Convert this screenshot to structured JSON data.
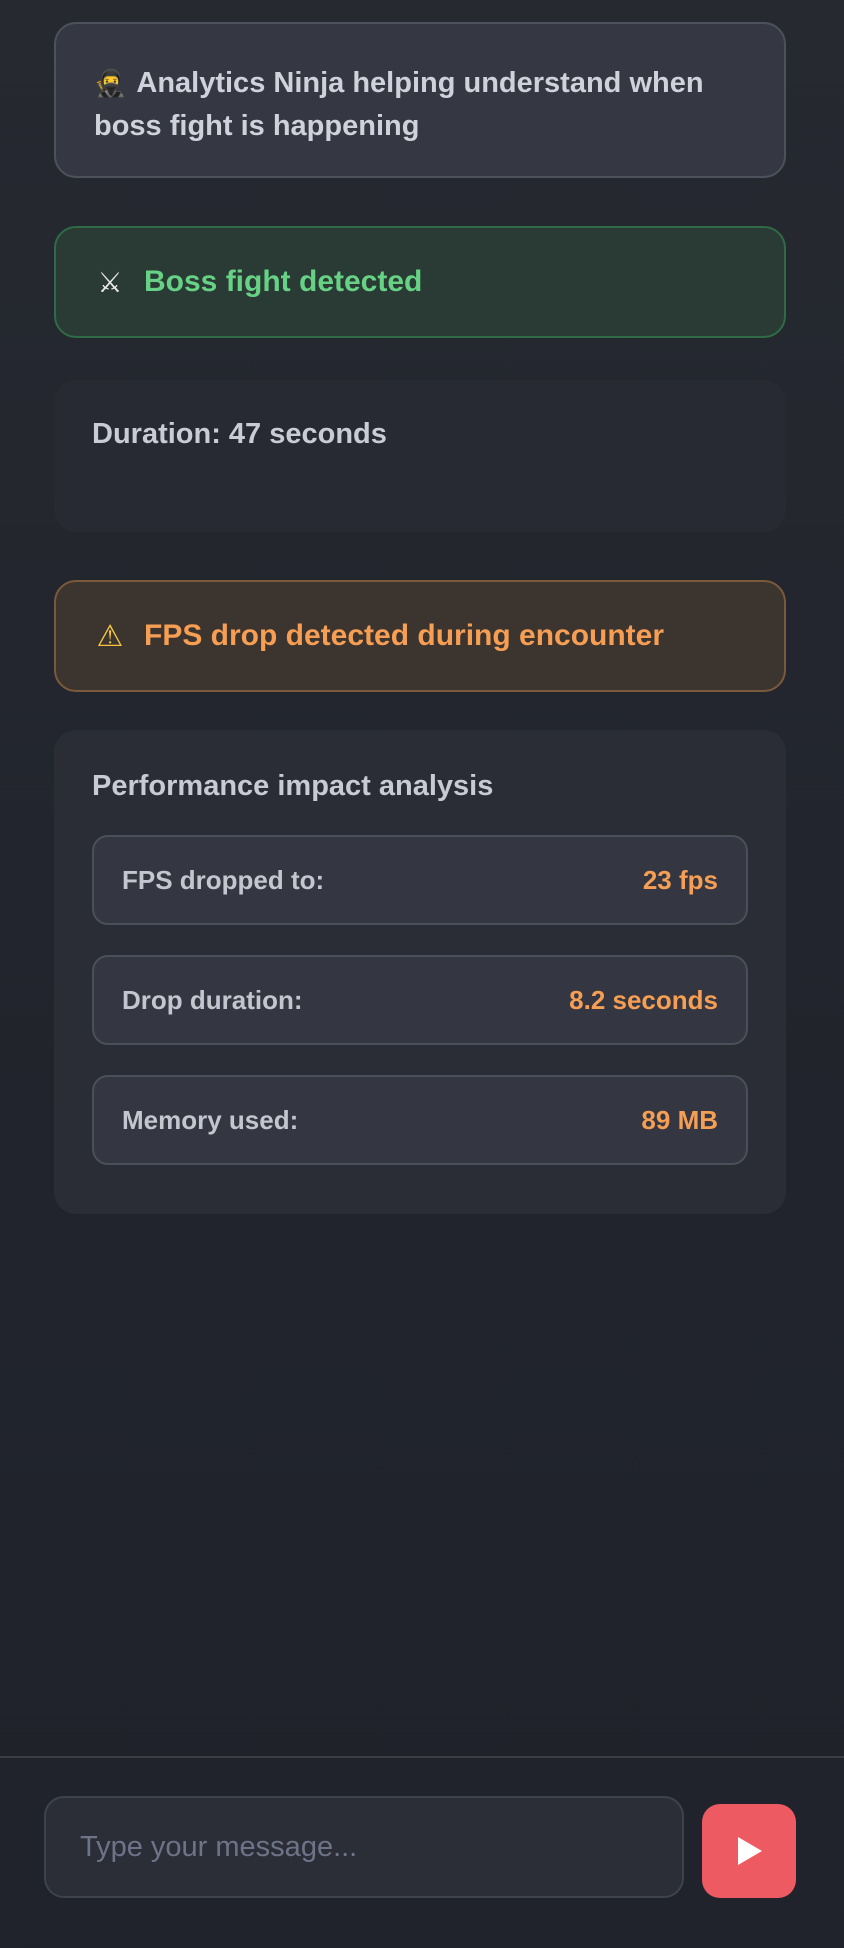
{
  "chat": {
    "intro": {
      "emoji": "🥷",
      "text": "Analytics Ninja helping understand when boss fight is happening"
    },
    "boss_alert": {
      "icon": "crossed-swords-icon",
      "glyph": "⚔",
      "text": "Boss fight detected"
    },
    "duration": {
      "text": "Duration: 47 seconds"
    },
    "fps_warning": {
      "icon": "warning-icon",
      "glyph": "⚠",
      "text": "FPS drop detected during encounter"
    },
    "analysis": {
      "title": "Performance impact analysis",
      "metrics": [
        {
          "label": "FPS dropped to:",
          "value": "23 fps"
        },
        {
          "label": "Drop duration:",
          "value": "8.2 seconds"
        },
        {
          "label": "Memory used:",
          "value": "89 MB"
        }
      ]
    }
  },
  "composer": {
    "placeholder": "Type your message...",
    "value": "",
    "send_icon": "play-icon"
  },
  "colors": {
    "background": "#22252d",
    "success": "#67d185",
    "warning": "#f59e54",
    "send_button": "#ee5a62"
  }
}
